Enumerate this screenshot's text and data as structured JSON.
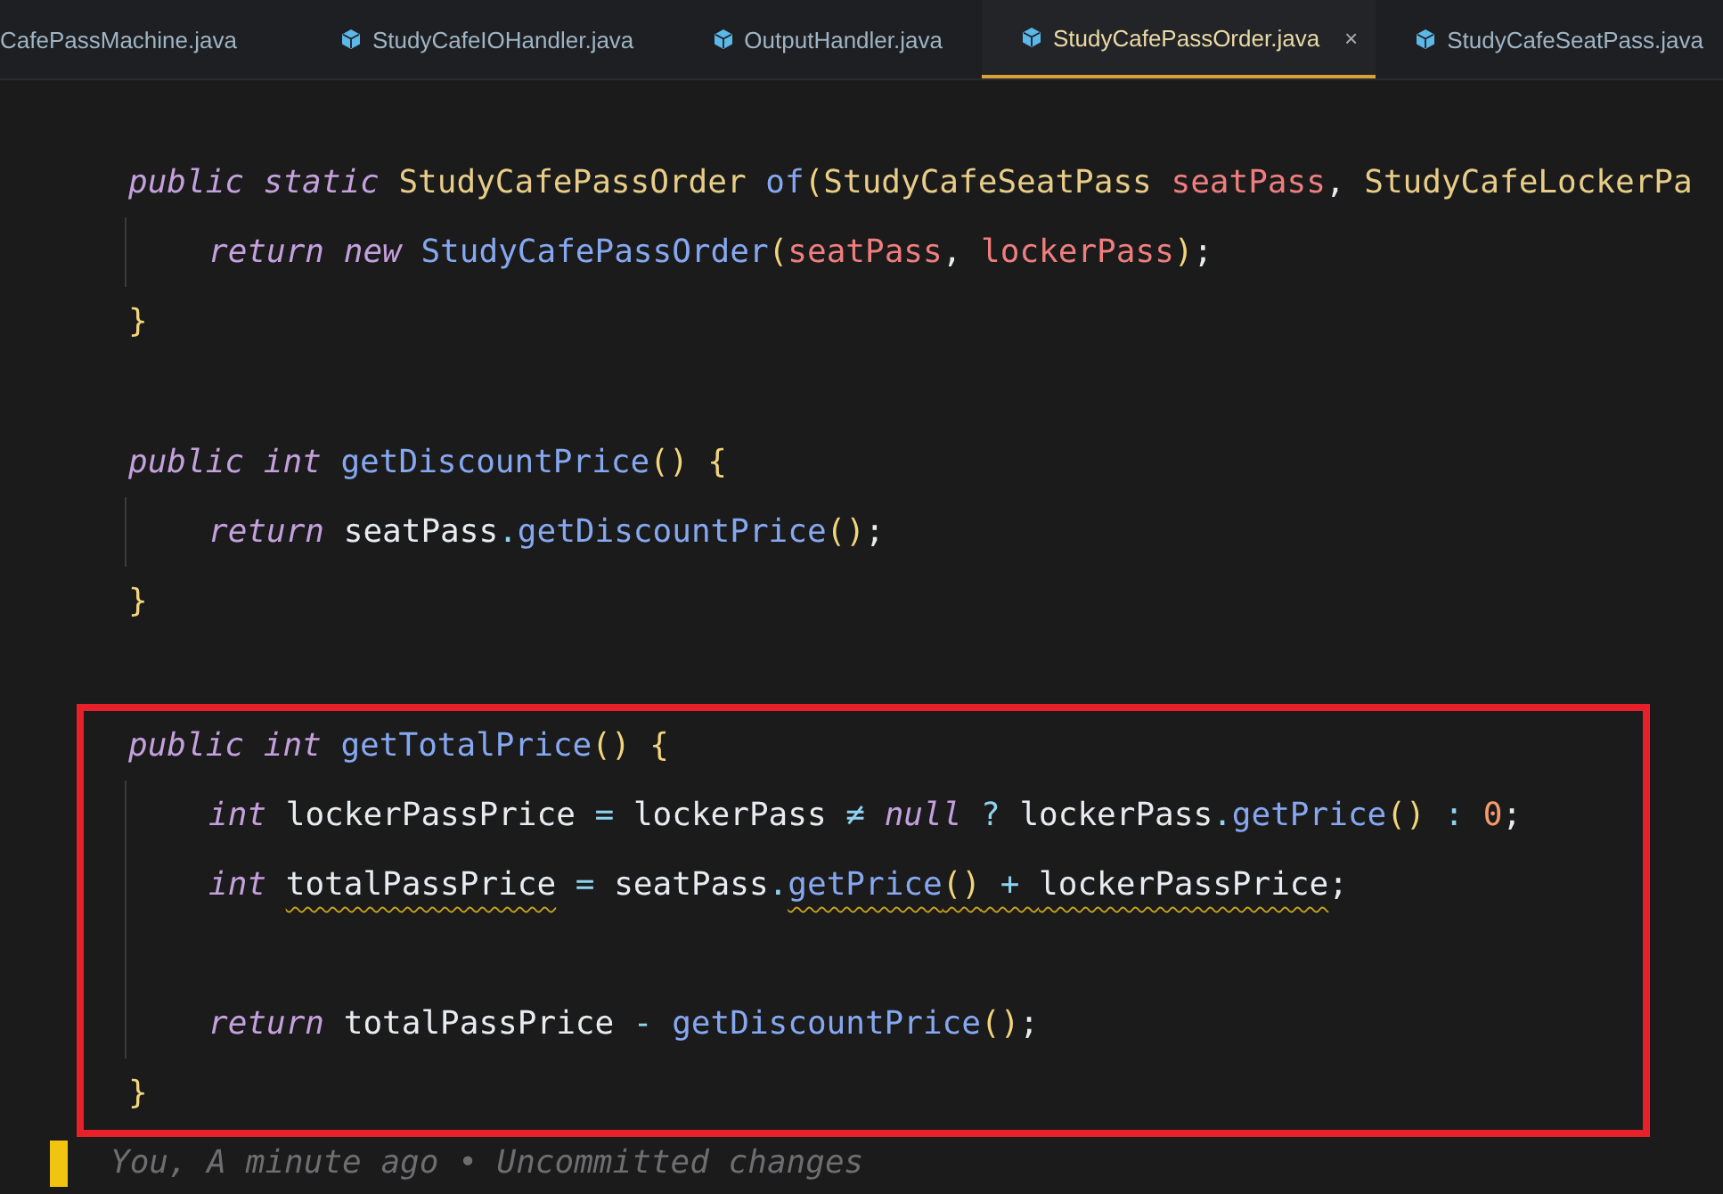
{
  "tabs": [
    {
      "label": "CafePassMachine.java",
      "icon": false,
      "selected": false
    },
    {
      "label": "StudyCafeIOHandler.java",
      "icon": true,
      "selected": false
    },
    {
      "label": "OutputHandler.java",
      "icon": true,
      "selected": false
    },
    {
      "label": "StudyCafePassOrder.java",
      "icon": true,
      "selected": true,
      "close": "×"
    },
    {
      "label": "StudyCafeSeatPass.java",
      "icon": true,
      "selected": false
    }
  ],
  "code": [
    {
      "highlighted": false,
      "tokens": [
        {
          "text": "public static ",
          "kind": "keyword"
        },
        {
          "text": "StudyCafePassOrder",
          "kind": "type"
        },
        {
          "text": " of",
          "kind": "method"
        },
        {
          "text": "(",
          "kind": "paren"
        },
        {
          "text": "StudyCafeSeatPass",
          "kind": "type"
        },
        {
          "text": " seatPass",
          "kind": "param"
        },
        {
          "text": ", ",
          "kind": "plain"
        },
        {
          "text": "StudyCafeLockerPa",
          "kind": "type"
        }
      ],
      "children": [
        {
          "tokens": [
            {
              "text": "return new ",
              "kind": "keyword"
            },
            {
              "text": "StudyCafePassOrder",
              "kind": "method"
            },
            {
              "text": "(",
              "kind": "paren"
            },
            {
              "text": "seatPass",
              "kind": "param"
            },
            {
              "text": ", ",
              "kind": "plain"
            },
            {
              "text": "lockerPass",
              "kind": "param"
            },
            {
              "text": ")",
              "kind": "paren"
            },
            {
              "text": ";",
              "kind": "plain"
            }
          ]
        }
      ]
    },
    {
      "highlighted": false,
      "tokens": [
        {
          "text": "}",
          "kind": "paren"
        }
      ]
    },
    {
      "kind": "blank",
      "highlighted": false
    },
    {
      "highlighted": false,
      "tokens": [
        {
          "text": "public int ",
          "kind": "keyword"
        },
        {
          "text": "getDiscountPrice",
          "kind": "method"
        },
        {
          "text": "() {",
          "kind": "paren"
        }
      ],
      "children": [
        {
          "tokens": [
            {
              "text": "return ",
              "kind": "keyword"
            },
            {
              "text": "seatPass",
              "kind": "plain"
            },
            {
              "text": ".",
              "kind": "operator"
            },
            {
              "text": "getDiscountPrice",
              "kind": "method"
            },
            {
              "text": "()",
              "kind": "paren"
            },
            {
              "text": ";",
              "kind": "plain"
            }
          ]
        }
      ]
    },
    {
      "highlighted": false,
      "tokens": [
        {
          "text": "}",
          "kind": "paren"
        }
      ]
    },
    {
      "kind": "blank",
      "highlighted": false
    },
    {
      "highlighted": true,
      "tokens": [
        {
          "text": "public int ",
          "kind": "keyword"
        },
        {
          "text": "getTotalPrice",
          "kind": "method"
        },
        {
          "text": "() {",
          "kind": "paren"
        }
      ],
      "children": [
        {
          "tokens": [
            {
              "text": "int ",
              "kind": "keyword"
            },
            {
              "text": "lockerPassPrice",
              "kind": "plain"
            },
            {
              "text": " = ",
              "kind": "operator"
            },
            {
              "text": "lockerPass",
              "kind": "plain"
            },
            {
              "text": " ≠ ",
              "kind": "operator"
            },
            {
              "text": "null",
              "kind": "keyword"
            },
            {
              "text": " ? ",
              "kind": "operator"
            },
            {
              "text": "lockerPass",
              "kind": "plain"
            },
            {
              "text": ".",
              "kind": "operator"
            },
            {
              "text": "getPrice",
              "kind": "method"
            },
            {
              "text": "()",
              "kind": "paren"
            },
            {
              "text": " : ",
              "kind": "operator"
            },
            {
              "text": "0",
              "kind": "number"
            },
            {
              "text": ";",
              "kind": "plain"
            }
          ]
        },
        {
          "tokens": [
            {
              "text": "int ",
              "kind": "keyword"
            },
            {
              "text": "totalPassPrice",
              "kind": "plain",
              "warning": true
            },
            {
              "text": " = ",
              "kind": "operator"
            },
            {
              "text": "seatPass",
              "kind": "plain"
            },
            {
              "text": ".",
              "kind": "operator"
            },
            {
              "text": "getPrice",
              "kind": "method",
              "warning": true
            },
            {
              "text": "()",
              "kind": "paren",
              "warning": true
            },
            {
              "text": " + ",
              "kind": "operator",
              "warning": true
            },
            {
              "text": "lockerPassPrice",
              "kind": "plain",
              "warning": true
            },
            {
              "text": ";",
              "kind": "plain"
            }
          ]
        },
        {
          "kind": "blank"
        },
        {
          "tokens": [
            {
              "text": "return ",
              "kind": "keyword"
            },
            {
              "text": "totalPassPrice",
              "kind": "plain"
            },
            {
              "text": " - ",
              "kind": "operator"
            },
            {
              "text": "getDiscountPrice",
              "kind": "method"
            },
            {
              "text": "()",
              "kind": "paren"
            },
            {
              "text": ";",
              "kind": "plain"
            }
          ]
        }
      ]
    },
    {
      "highlighted": true,
      "tokens": [
        {
          "text": "}",
          "kind": "paren"
        }
      ]
    }
  ],
  "blame": {
    "text": "You, A minute ago • Uncommitted changes",
    "modified": true
  }
}
